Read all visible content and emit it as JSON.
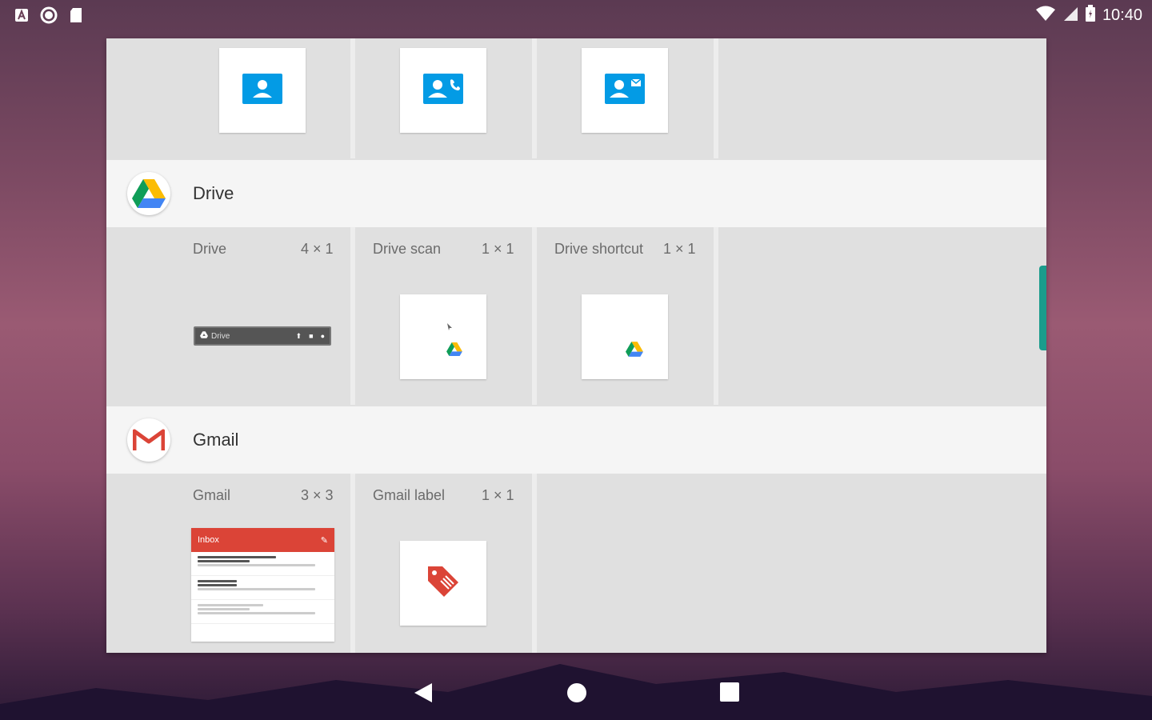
{
  "status_bar": {
    "time": "10:40",
    "left_icons": [
      "a-notification-icon",
      "circle-notification-icon",
      "sd-card-icon"
    ],
    "right_icons": [
      "wifi-icon",
      "cell-signal-icon",
      "battery-icon"
    ]
  },
  "contacts_row": {
    "widgets": [
      {
        "icon": "contact-card-icon"
      },
      {
        "icon": "contact-call-icon"
      },
      {
        "icon": "contact-message-icon"
      }
    ]
  },
  "drive": {
    "app_name": "Drive",
    "widgets": [
      {
        "label": "Drive",
        "size": "4 × 1",
        "preview_text": "Drive"
      },
      {
        "label": "Drive scan",
        "size": "1 × 1"
      },
      {
        "label": "Drive shortcut",
        "size": "1 × 1"
      }
    ]
  },
  "gmail": {
    "app_name": "Gmail",
    "widgets": [
      {
        "label": "Gmail",
        "size": "3 × 3",
        "preview_header": "Inbox"
      },
      {
        "label": "Gmail label",
        "size": "1 × 1"
      }
    ]
  },
  "nav": {
    "buttons": [
      "back",
      "home",
      "recents"
    ]
  },
  "colors": {
    "accent_teal": "#1a9c8c",
    "gmail_red": "#db4437",
    "contact_blue": "#039be5"
  }
}
